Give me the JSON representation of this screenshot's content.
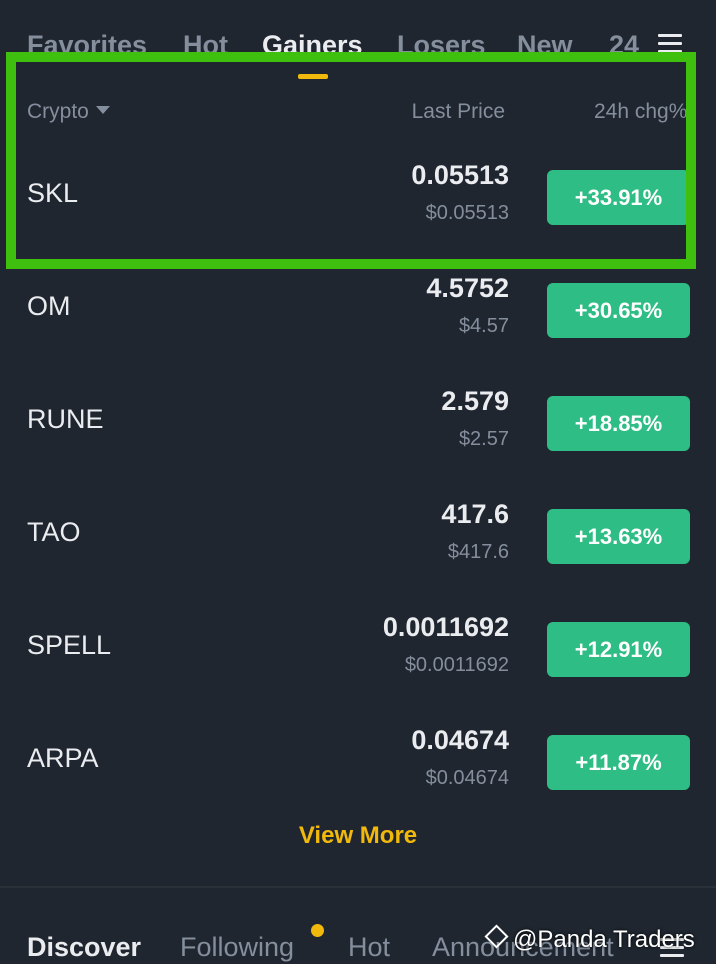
{
  "top_tabs": [
    {
      "label": "Favorites",
      "active": false
    },
    {
      "label": "Hot",
      "active": false
    },
    {
      "label": "Gainers",
      "active": true
    },
    {
      "label": "Losers",
      "active": false
    },
    {
      "label": "New",
      "active": false
    },
    {
      "label": "24",
      "active": false
    }
  ],
  "columns": {
    "crypto": "Crypto",
    "last_price": "Last Price",
    "change": "24h chg%"
  },
  "rows": [
    {
      "symbol": "SKL",
      "price": "0.05513",
      "fiat": "$0.05513",
      "change": "+33.91%"
    },
    {
      "symbol": "OM",
      "price": "4.5752",
      "fiat": "$4.57",
      "change": "+30.65%"
    },
    {
      "symbol": "RUNE",
      "price": "2.579",
      "fiat": "$2.57",
      "change": "+18.85%"
    },
    {
      "symbol": "TAO",
      "price": "417.6",
      "fiat": "$417.6",
      "change": "+13.63%"
    },
    {
      "symbol": "SPELL",
      "price": "0.0011692",
      "fiat": "$0.0011692",
      "change": "+12.91%"
    },
    {
      "symbol": "ARPA",
      "price": "0.04674",
      "fiat": "$0.04674",
      "change": "+11.87%"
    }
  ],
  "view_more": "View More",
  "bottom_tabs": [
    {
      "label": "Discover",
      "active": true
    },
    {
      "label": "Following",
      "active": false
    },
    {
      "label": "Hot",
      "active": false
    },
    {
      "label": "Announcement",
      "active": false
    }
  ],
  "watermark": "@Panda Traders",
  "colors": {
    "background": "#1f2630",
    "accent": "#f0b90b",
    "positive": "#2ebd85",
    "highlight": "#3fbf0e"
  },
  "icons": {
    "sort": "caret-down-icon",
    "menu": "menu-icon",
    "notification": "notification-dot-icon"
  }
}
